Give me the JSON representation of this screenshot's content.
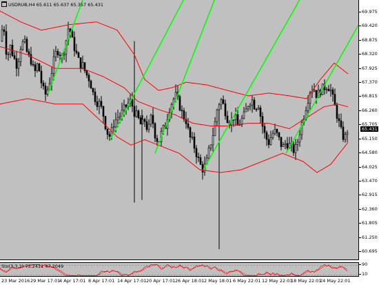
{
  "header": {
    "symbol_text": "USDRUB,H4",
    "ohlc_text": "65.611 65.637 65.357 65.431"
  },
  "indicator": {
    "label": "Sto(3,3,2) 73.2411 47.2049",
    "axis_top": "90",
    "axis_bottom": "10"
  },
  "current_price": "65.431",
  "price_axis": [
    "69.975",
    "69.420",
    "68.875",
    "68.320",
    "67.925",
    "67.370",
    "66.815",
    "66.260",
    "65.705",
    "65.150",
    "64.580",
    "64.025",
    "63.470",
    "62.915",
    "62.360",
    "61.805",
    "61.250",
    "60.695"
  ],
  "time_axis": [
    "23 Mar 2016",
    "29 Mar 17:01",
    "4 Apr 17:01",
    "8 Apr 17:01",
    "14 Apr 17:01",
    "20 Apr 17:01",
    "26 Apr 18:01",
    "2 May 18:01",
    "6 May 22:01",
    "12 May 22:01",
    "18 May 22:01",
    "24 May 22:01"
  ],
  "colors": {
    "background": "#c0c0c0",
    "candle": "#000000",
    "band": "#ff0000",
    "trendline": "#00ff00",
    "text": "#000000"
  },
  "chart_data": {
    "type": "candlestick",
    "symbol": "USDRUB",
    "timeframe": "H4",
    "ylim": [
      60.6,
      70.1
    ],
    "last_close": 65.431,
    "price_path": [
      [
        0,
        68.6
      ],
      [
        5,
        69.3
      ],
      [
        10,
        68.0
      ],
      [
        15,
        68.4
      ],
      [
        20,
        68.0
      ],
      [
        25,
        67.7
      ],
      [
        30,
        68.4
      ],
      [
        35,
        68.6
      ],
      [
        40,
        68.1
      ],
      [
        45,
        67.9
      ],
      [
        50,
        67.4
      ],
      [
        55,
        67.8
      ],
      [
        60,
        67.1
      ],
      [
        65,
        66.6
      ],
      [
        70,
        66.9
      ],
      [
        75,
        67.5
      ],
      [
        80,
        68.1
      ],
      [
        85,
        68.3
      ],
      [
        90,
        68.0
      ],
      [
        95,
        68.5
      ],
      [
        100,
        69.2
      ],
      [
        105,
        68.6
      ],
      [
        110,
        68.2
      ],
      [
        115,
        67.8
      ],
      [
        120,
        67.7
      ],
      [
        125,
        67.4
      ],
      [
        130,
        67.2
      ],
      [
        135,
        66.7
      ],
      [
        140,
        66.4
      ],
      [
        145,
        66.3
      ],
      [
        150,
        65.9
      ],
      [
        155,
        65.3
      ],
      [
        160,
        65.1
      ],
      [
        165,
        65.6
      ],
      [
        170,
        65.8
      ],
      [
        175,
        65.9
      ],
      [
        180,
        66.1
      ],
      [
        185,
        66.3
      ],
      [
        190,
        66.4
      ],
      [
        195,
        66.0
      ],
      [
        200,
        65.8
      ],
      [
        205,
        65.5
      ],
      [
        210,
        65.7
      ],
      [
        215,
        65.3
      ],
      [
        220,
        65.9
      ],
      [
        225,
        65.2
      ],
      [
        230,
        64.9
      ],
      [
        235,
        65.3
      ],
      [
        240,
        65.5
      ],
      [
        245,
        66.1
      ],
      [
        250,
        66.4
      ],
      [
        255,
        66.6
      ],
      [
        260,
        66.3
      ],
      [
        265,
        65.9
      ],
      [
        270,
        65.7
      ],
      [
        275,
        65.1
      ],
      [
        280,
        64.9
      ],
      [
        285,
        64.5
      ],
      [
        290,
        64.1
      ],
      [
        295,
        63.9
      ],
      [
        300,
        64.2
      ],
      [
        305,
        64.8
      ],
      [
        310,
        65.3
      ],
      [
        315,
        66.1
      ],
      [
        320,
        66.5
      ],
      [
        325,
        66.2
      ],
      [
        330,
        65.8
      ],
      [
        335,
        65.6
      ],
      [
        340,
        65.9
      ],
      [
        345,
        65.5
      ],
      [
        350,
        65.7
      ],
      [
        355,
        65.9
      ],
      [
        360,
        66.3
      ],
      [
        365,
        66.5
      ],
      [
        370,
        66.2
      ],
      [
        375,
        66.3
      ],
      [
        380,
        65.6
      ],
      [
        385,
        65.1
      ],
      [
        390,
        64.9
      ],
      [
        395,
        65.2
      ],
      [
        400,
        65.3
      ],
      [
        405,
        65.0
      ],
      [
        410,
        64.7
      ],
      [
        415,
        64.9
      ],
      [
        420,
        64.8
      ],
      [
        425,
        64.6
      ],
      [
        430,
        64.7
      ],
      [
        435,
        65.3
      ],
      [
        440,
        65.8
      ],
      [
        445,
        66.3
      ],
      [
        450,
        66.8
      ],
      [
        455,
        66.9
      ],
      [
        460,
        66.6
      ],
      [
        465,
        66.8
      ],
      [
        470,
        66.9
      ],
      [
        475,
        67.0
      ],
      [
        480,
        66.8
      ],
      [
        485,
        66.3
      ],
      [
        490,
        65.8
      ],
      [
        495,
        65.3
      ],
      [
        500,
        65.0
      ],
      [
        505,
        65.431
      ]
    ],
    "spikes": [
      {
        "x": 195,
        "high": 68.6,
        "low": 62.7
      },
      {
        "x": 206,
        "high": 66.1,
        "low": 62.8
      },
      {
        "x": 318,
        "high": 66.1,
        "low": 61.0
      }
    ],
    "bands": {
      "upper": [
        [
          0,
          69.7
        ],
        [
          30,
          69.3
        ],
        [
          60,
          69.0
        ],
        [
          100,
          69.2
        ],
        [
          140,
          69.3
        ],
        [
          170,
          69.0
        ],
        [
          195,
          68.1
        ],
        [
          210,
          67.2
        ],
        [
          230,
          66.8
        ],
        [
          250,
          66.9
        ],
        [
          270,
          67.1
        ],
        [
          300,
          67.0
        ],
        [
          330,
          66.8
        ],
        [
          360,
          66.6
        ],
        [
          390,
          66.7
        ],
        [
          420,
          66.6
        ],
        [
          445,
          66.5
        ],
        [
          465,
          67.2
        ],
        [
          485,
          67.8
        ],
        [
          505,
          67.4
        ]
      ],
      "middle": [
        [
          0,
          68.4
        ],
        [
          40,
          68.1
        ],
        [
          80,
          67.6
        ],
        [
          120,
          67.6
        ],
        [
          150,
          67.3
        ],
        [
          180,
          66.9
        ],
        [
          200,
          66.4
        ],
        [
          230,
          66.1
        ],
        [
          255,
          65.9
        ],
        [
          280,
          65.6
        ],
        [
          305,
          65.5
        ],
        [
          330,
          65.5
        ],
        [
          360,
          65.6
        ],
        [
          390,
          65.6
        ],
        [
          420,
          65.4
        ],
        [
          445,
          65.8
        ],
        [
          470,
          66.2
        ],
        [
          490,
          66.3
        ],
        [
          505,
          66.2
        ]
      ],
      "lower": [
        [
          0,
          66.3
        ],
        [
          40,
          66.5
        ],
        [
          80,
          66.3
        ],
        [
          120,
          66.3
        ],
        [
          150,
          65.6
        ],
        [
          170,
          65.1
        ],
        [
          190,
          64.8
        ],
        [
          210,
          65.0
        ],
        [
          230,
          64.8
        ],
        [
          260,
          64.5
        ],
        [
          290,
          63.9
        ],
        [
          320,
          63.8
        ],
        [
          350,
          63.9
        ],
        [
          380,
          64.2
        ],
        [
          410,
          64.5
        ],
        [
          440,
          64.2
        ],
        [
          460,
          63.8
        ],
        [
          480,
          64.1
        ],
        [
          505,
          64.9
        ]
      ]
    },
    "trendlines": [
      {
        "x1": 70,
        "y1": 66.7,
        "x2": 120,
        "y2": 70.1
      },
      {
        "x1": 160,
        "y1": 65.0,
        "x2": 285,
        "y2": 71.0
      },
      {
        "x1": 225,
        "y1": 64.5,
        "x2": 325,
        "y2": 71.0
      },
      {
        "x1": 295,
        "y1": 63.9,
        "x2": 455,
        "y2": 71.0
      },
      {
        "x1": 415,
        "y1": 64.5,
        "x2": 525,
        "y2": 69.4
      }
    ],
    "stochastic": {
      "k": 73.2411,
      "d": 47.2049,
      "ylim": [
        0,
        100
      ],
      "levels": [
        10,
        90
      ]
    }
  }
}
